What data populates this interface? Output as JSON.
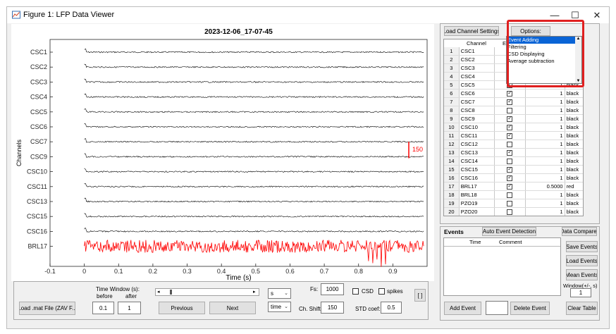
{
  "window": {
    "title": "Figure 1: LFP Data Viewer",
    "minimize": "—",
    "maximize": "☐",
    "close": "✕"
  },
  "plot": {
    "title": "2023-12-06_17-07-45",
    "ylabel": "Channels",
    "xlabel": "Time (s)",
    "x_ticks": [
      "-0.1",
      "0",
      "0.1",
      "0.2",
      "0.3",
      "0.4",
      "0.5",
      "0.6",
      "0.7",
      "0.8",
      "0.9"
    ],
    "channels": [
      "CSC1",
      "CSC2",
      "CSC3",
      "CSC4",
      "CSC5",
      "CSC6",
      "CSC7",
      "CSC9",
      "CSC10",
      "CSC11",
      "CSC13",
      "CSC15",
      "CSC16",
      "BRL17"
    ],
    "scale_label": "150",
    "trace_color": "#000000",
    "highlight_color": "#ff0000"
  },
  "chart_data": {
    "type": "line",
    "title": "2023-12-06_17-07-45",
    "xlabel": "Time (s)",
    "ylabel": "Channels",
    "xlim": [
      -0.1,
      1.0
    ],
    "categories": [
      "CSC1",
      "CSC2",
      "CSC3",
      "CSC4",
      "CSC5",
      "CSC6",
      "CSC7",
      "CSC9",
      "CSC10",
      "CSC11",
      "CSC13",
      "CSC15",
      "CSC16",
      "BRL17"
    ],
    "x_start": 0,
    "x_end": 0.99,
    "scale_bar_value": 150
  },
  "controls": {
    "load_file": "Load .mat File (ZAV F...",
    "time_window_label": "Time Window (s):",
    "before_label": "before",
    "after_label": "after",
    "before_value": "0.1",
    "after_value": "1",
    "previous": "Previous",
    "next": "Next",
    "unit_select": "s",
    "mode_select": "time",
    "fs_label": "Fs:",
    "fs_value": "1000",
    "ch_shift_label": "Ch. Shift:",
    "ch_shift_value": "150",
    "csd_label": "CSD",
    "spikes_label": "spikes",
    "std_label": "STD coef:",
    "std_value": "0.5",
    "bracket_button": "[ ]"
  },
  "channel_panel": {
    "load_settings": "Load Channel Settings",
    "options_button": "Options:",
    "options": [
      "Event Adding",
      "Filtering",
      "CSD Displaying",
      "Average subtraction"
    ],
    "col_channel": "Channel",
    "col_enabled": "Ena",
    "rows": [
      {
        "n": "1",
        "name": "CSC1",
        "on": true,
        "scale": "",
        "color": ""
      },
      {
        "n": "2",
        "name": "CSC2",
        "on": true,
        "scale": "",
        "color": ""
      },
      {
        "n": "3",
        "name": "CSC3",
        "on": true,
        "scale": "",
        "color": ""
      },
      {
        "n": "4",
        "name": "CSC4",
        "on": true,
        "scale": "",
        "color": ""
      },
      {
        "n": "5",
        "name": "CSC5",
        "on": true,
        "scale": "1",
        "color": "black"
      },
      {
        "n": "6",
        "name": "CSC6",
        "on": true,
        "scale": "1",
        "color": "black"
      },
      {
        "n": "7",
        "name": "CSC7",
        "on": true,
        "scale": "1",
        "color": "black"
      },
      {
        "n": "8",
        "name": "CSC8",
        "on": false,
        "scale": "1",
        "color": "black"
      },
      {
        "n": "9",
        "name": "CSC9",
        "on": true,
        "scale": "1",
        "color": "black"
      },
      {
        "n": "10",
        "name": "CSC10",
        "on": true,
        "scale": "1",
        "color": "black"
      },
      {
        "n": "11",
        "name": "CSC11",
        "on": true,
        "scale": "1",
        "color": "black"
      },
      {
        "n": "12",
        "name": "CSC12",
        "on": false,
        "scale": "1",
        "color": "black"
      },
      {
        "n": "13",
        "name": "CSC13",
        "on": true,
        "scale": "1",
        "color": "black"
      },
      {
        "n": "14",
        "name": "CSC14",
        "on": false,
        "scale": "1",
        "color": "black"
      },
      {
        "n": "15",
        "name": "CSC15",
        "on": true,
        "scale": "1",
        "color": "black"
      },
      {
        "n": "16",
        "name": "CSC16",
        "on": true,
        "scale": "1",
        "color": "black"
      },
      {
        "n": "17",
        "name": "BRL17",
        "on": true,
        "scale": "0.5000",
        "color": "red"
      },
      {
        "n": "18",
        "name": "BRL18",
        "on": false,
        "scale": "1",
        "color": "black"
      },
      {
        "n": "19",
        "name": "PZO19",
        "on": false,
        "scale": "1",
        "color": "black"
      },
      {
        "n": "20",
        "name": "PZO20",
        "on": false,
        "scale": "1",
        "color": "black"
      }
    ]
  },
  "events_panel": {
    "title": "Events",
    "auto_detect": "Auto Event Detection",
    "data_comparer": "Data Comparer",
    "col_time": "Time",
    "col_comment": "Comment",
    "save_events": "Save Events",
    "load_events": "Load Events",
    "mean_events": "Mean Events",
    "window_label": "Window(+/-, s)",
    "window_value": "1",
    "add_event": "Add Event",
    "delete_event": "Delete Event",
    "clear_table": "Clear Table"
  },
  "highlight_color": "#e02020"
}
